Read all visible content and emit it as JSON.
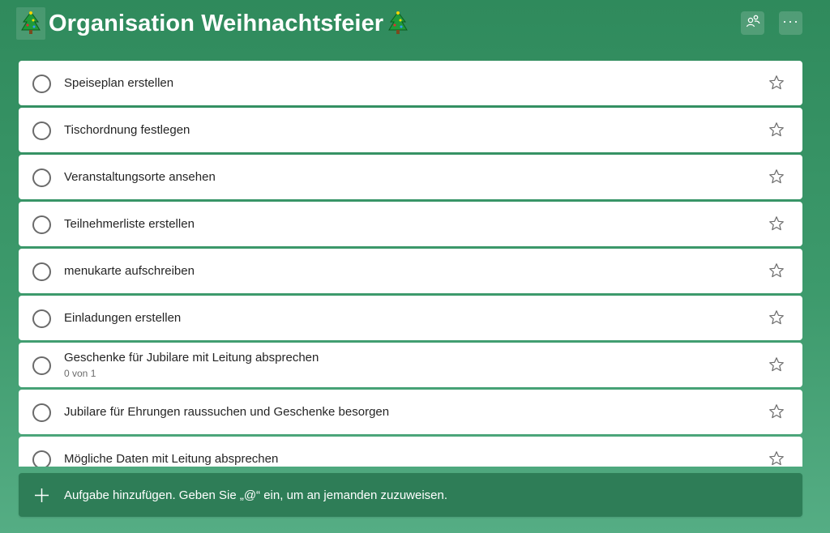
{
  "header": {
    "title": "Organisation Weihnachtsfeier",
    "emoji": "🎄",
    "share_icon": "share-people-icon",
    "more_icon": "more-dots-icon"
  },
  "tasks": [
    {
      "title": "Speiseplan erstellen",
      "sub": ""
    },
    {
      "title": "Tischordnung festlegen",
      "sub": ""
    },
    {
      "title": "Veranstaltungsorte ansehen",
      "sub": ""
    },
    {
      "title": "Teilnehmerliste erstellen",
      "sub": ""
    },
    {
      "title": "menukarte aufschreiben",
      "sub": ""
    },
    {
      "title": "Einladungen erstellen",
      "sub": ""
    },
    {
      "title": "Geschenke für Jubilare mit Leitung absprechen",
      "sub": "0 von 1"
    },
    {
      "title": "Jubilare für Ehrungen raussuchen und Geschenke besorgen",
      "sub": ""
    },
    {
      "title": "Mögliche Daten mit Leitung absprechen",
      "sub": ""
    }
  ],
  "add_task": {
    "placeholder": "Aufgabe hinzufügen. Geben Sie „@“ ein, um an jemanden zuzuweisen."
  },
  "colors": {
    "accent": "#2e7d57",
    "background_top": "#2f8a5c",
    "background_bottom": "#55ad84"
  }
}
